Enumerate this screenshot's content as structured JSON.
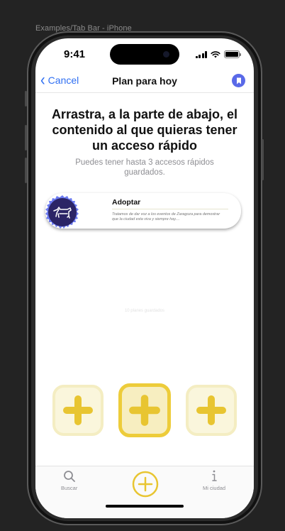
{
  "frame_label": "Examples/Tab Bar - iPhone",
  "status_bar": {
    "time": "9:41"
  },
  "nav": {
    "cancel_label": "Cancel",
    "title": "Plan para hoy",
    "bookmark_icon": "bookmark-icon"
  },
  "content": {
    "headline": "Arrastra, a la parte de abajo, el contenido al que quieras tener un acceso rápido",
    "subtitle": "Puedes tener hasta 3 accesos rápidos guardados.",
    "card": {
      "title": "Adoptar",
      "description": "Tratamos de dar voz a los eventos de Zaragoza para demostrar que la ciudad esta viva y siempre hay....",
      "icon": "dog-icon"
    },
    "empty_hint": "10 planes guardados"
  },
  "quick_slots": [
    {
      "icon": "plus-icon",
      "state": "inactive"
    },
    {
      "icon": "plus-icon",
      "state": "active"
    },
    {
      "icon": "plus-icon",
      "state": "inactive"
    }
  ],
  "tabbar": {
    "search_label": "Buscar",
    "center_icon": "plus-circle-icon",
    "city_label": "Mi ciudad"
  },
  "colors": {
    "accent_yellow": "#ECC81E",
    "accent_blue": "#2F6FF2",
    "badge_navy": "#2B2466",
    "bookmark_purple": "#5969E8"
  }
}
